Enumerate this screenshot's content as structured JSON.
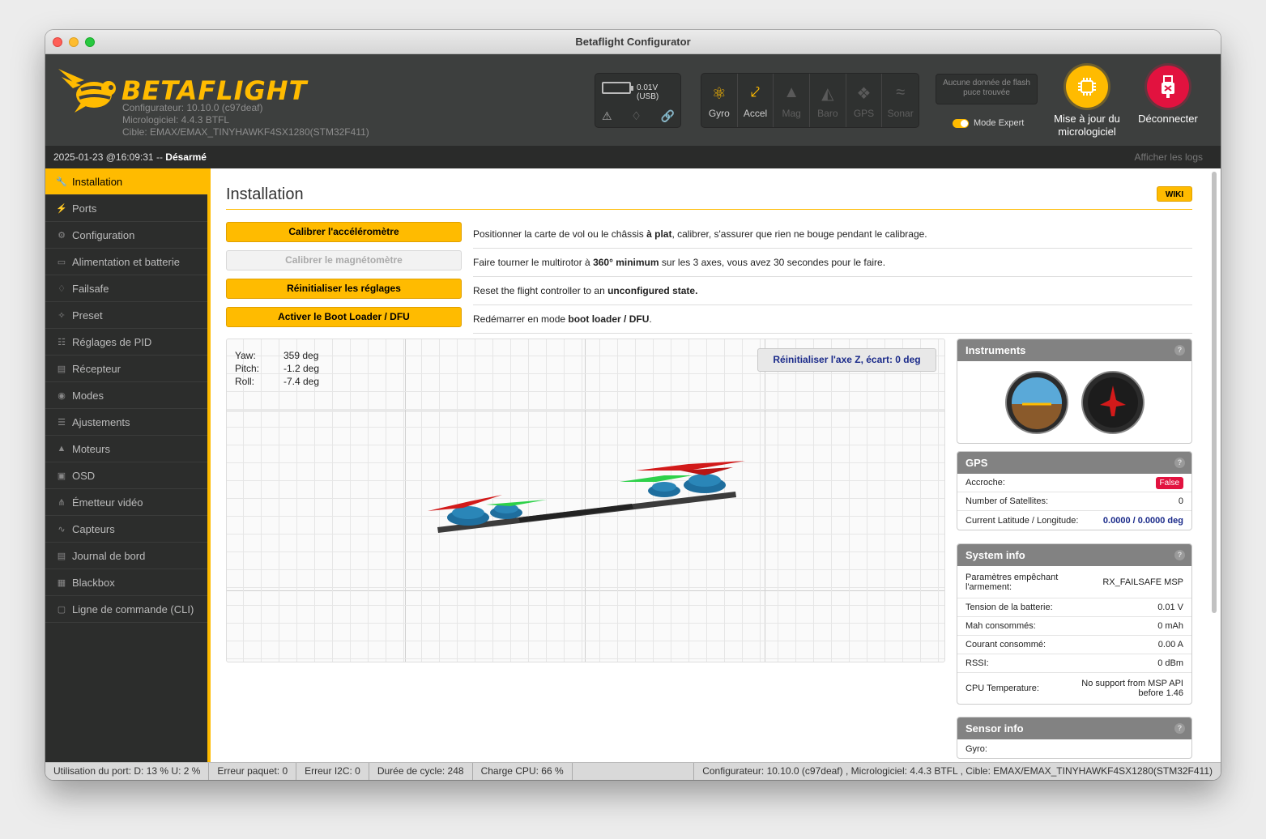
{
  "window": {
    "title": "Betaflight Configurator"
  },
  "header": {
    "brand": "BETAFLIGHT",
    "configurator_line": "Configurateur: 10.10.0 (c97deaf)",
    "firmware_line": "Micrologiciel: 4.4.3 BTFL",
    "target_line": "Cible: EMAX/EMAX_TINYHAWKF4SX1280(STM32F411)",
    "battery_label": "0.01V (USB)",
    "sensors": [
      {
        "label": "Gyro",
        "icon": "gyro-icon",
        "active": true
      },
      {
        "label": "Accel",
        "icon": "accel-icon",
        "active": true
      },
      {
        "label": "Mag",
        "icon": "mag-icon",
        "active": false
      },
      {
        "label": "Baro",
        "icon": "baro-icon",
        "active": false
      },
      {
        "label": "GPS",
        "icon": "gps-icon",
        "active": false
      },
      {
        "label": "Sonar",
        "icon": "sonar-icon",
        "active": false
      }
    ],
    "flash_status": "Aucune donnée de flash puce trouvée",
    "expert_mode_label": "Mode Expert",
    "update_label": "Mise à jour du micrologiciel",
    "disconnect_label": "Déconnecter",
    "accent_color": "#ffbb00",
    "danger_color": "#e2123f"
  },
  "status_top": {
    "timestamp": "2025-01-23 @16:09:31 --",
    "arm_state": "Désarmé",
    "show_logs": "Afficher les logs"
  },
  "sidebar": {
    "items": [
      {
        "label": "Installation",
        "icon": "wrench-icon",
        "active": true
      },
      {
        "label": "Ports",
        "icon": "plug-icon"
      },
      {
        "label": "Configuration",
        "icon": "gear-icon"
      },
      {
        "label": "Alimentation et batterie",
        "icon": "battery-icon"
      },
      {
        "label": "Failsafe",
        "icon": "parachute-icon"
      },
      {
        "label": "Preset",
        "icon": "magic-icon"
      },
      {
        "label": "Réglages de PID",
        "icon": "pid-icon"
      },
      {
        "label": "Récepteur",
        "icon": "receiver-icon"
      },
      {
        "label": "Modes",
        "icon": "toggle-icon"
      },
      {
        "label": "Ajustements",
        "icon": "sliders-icon"
      },
      {
        "label": "Moteurs",
        "icon": "motor-icon"
      },
      {
        "label": "OSD",
        "icon": "osd-icon"
      },
      {
        "label": "Émetteur vidéo",
        "icon": "antenna-icon"
      },
      {
        "label": "Capteurs",
        "icon": "pulse-icon"
      },
      {
        "label": "Journal de bord",
        "icon": "log-icon"
      },
      {
        "label": "Blackbox",
        "icon": "blackbox-icon"
      },
      {
        "label": "Ligne de commande (CLI)",
        "icon": "terminal-icon"
      }
    ]
  },
  "page": {
    "title": "Installation",
    "wiki": "WIKI",
    "actions": [
      {
        "button": "Calibrer l'accéléromètre",
        "disabled": false,
        "desc_pre": "Positionner la carte de vol ou le châssis ",
        "desc_bold": "à plat",
        "desc_post": ", calibrer, s'assurer que rien ne bouge pendant le calibrage."
      },
      {
        "button": "Calibrer le magnétomètre",
        "disabled": true,
        "desc_pre": "Faire tourner le multirotor à ",
        "desc_bold": "360° minimum",
        "desc_post": " sur les 3 axes, vous avez 30 secondes pour le faire."
      },
      {
        "button": "Réinitialiser les réglages",
        "disabled": false,
        "desc_pre": "Reset the flight controller to an ",
        "desc_bold": "unconfigured state.",
        "desc_post": ""
      },
      {
        "button": "Activer le Boot Loader / DFU",
        "disabled": false,
        "desc_pre": "Redémarrer en mode ",
        "desc_bold": "boot loader / DFU",
        "desc_post": "."
      }
    ],
    "attitude": {
      "yaw_label": "Yaw:",
      "yaw": "359 deg",
      "pitch_label": "Pitch:",
      "pitch": "-1.2 deg",
      "roll_label": "Roll:",
      "roll": "-7.4 deg"
    },
    "reset_z": "Réinitialiser l'axe Z, écart: 0 deg"
  },
  "panels": {
    "instruments": {
      "title": "Instruments"
    },
    "gps": {
      "title": "GPS",
      "rows": [
        {
          "label": "Accroche:",
          "value": "False"
        },
        {
          "label": "Number of Satellites:",
          "value": "0"
        },
        {
          "label": "Current Latitude / Longitude:",
          "value": "0.0000 / 0.0000 deg"
        }
      ]
    },
    "system": {
      "title": "System info",
      "rows": [
        {
          "label": "Paramètres empêchant l'armement:",
          "value": "RX_FAILSAFE  MSP"
        },
        {
          "label": "Tension de la batterie:",
          "value": "0.01 V"
        },
        {
          "label": "Mah consommés:",
          "value": "0 mAh"
        },
        {
          "label": "Courant consommé:",
          "value": "0.00 A"
        },
        {
          "label": "RSSI:",
          "value": "0 dBm"
        },
        {
          "label": "CPU Temperature:",
          "value": "No support from MSP API before 1.46"
        }
      ]
    },
    "sensor": {
      "title": "Sensor info",
      "rows": [
        {
          "label": "Gyro:",
          "value": ""
        }
      ]
    }
  },
  "footer": {
    "port_usage": "Utilisation du port: D: 13 % U: 2 %",
    "packet_error": "Erreur paquet: 0",
    "i2c_error": "Erreur I2C: 0",
    "cycle_time": "Durée de cycle: 248",
    "cpu_load": "Charge CPU: 66 %",
    "versions": "Configurateur: 10.10.0 (c97deaf) , Micrologiciel: 4.4.3 BTFL , Cible: EMAX/EMAX_TINYHAWKF4SX1280(STM32F411)"
  }
}
